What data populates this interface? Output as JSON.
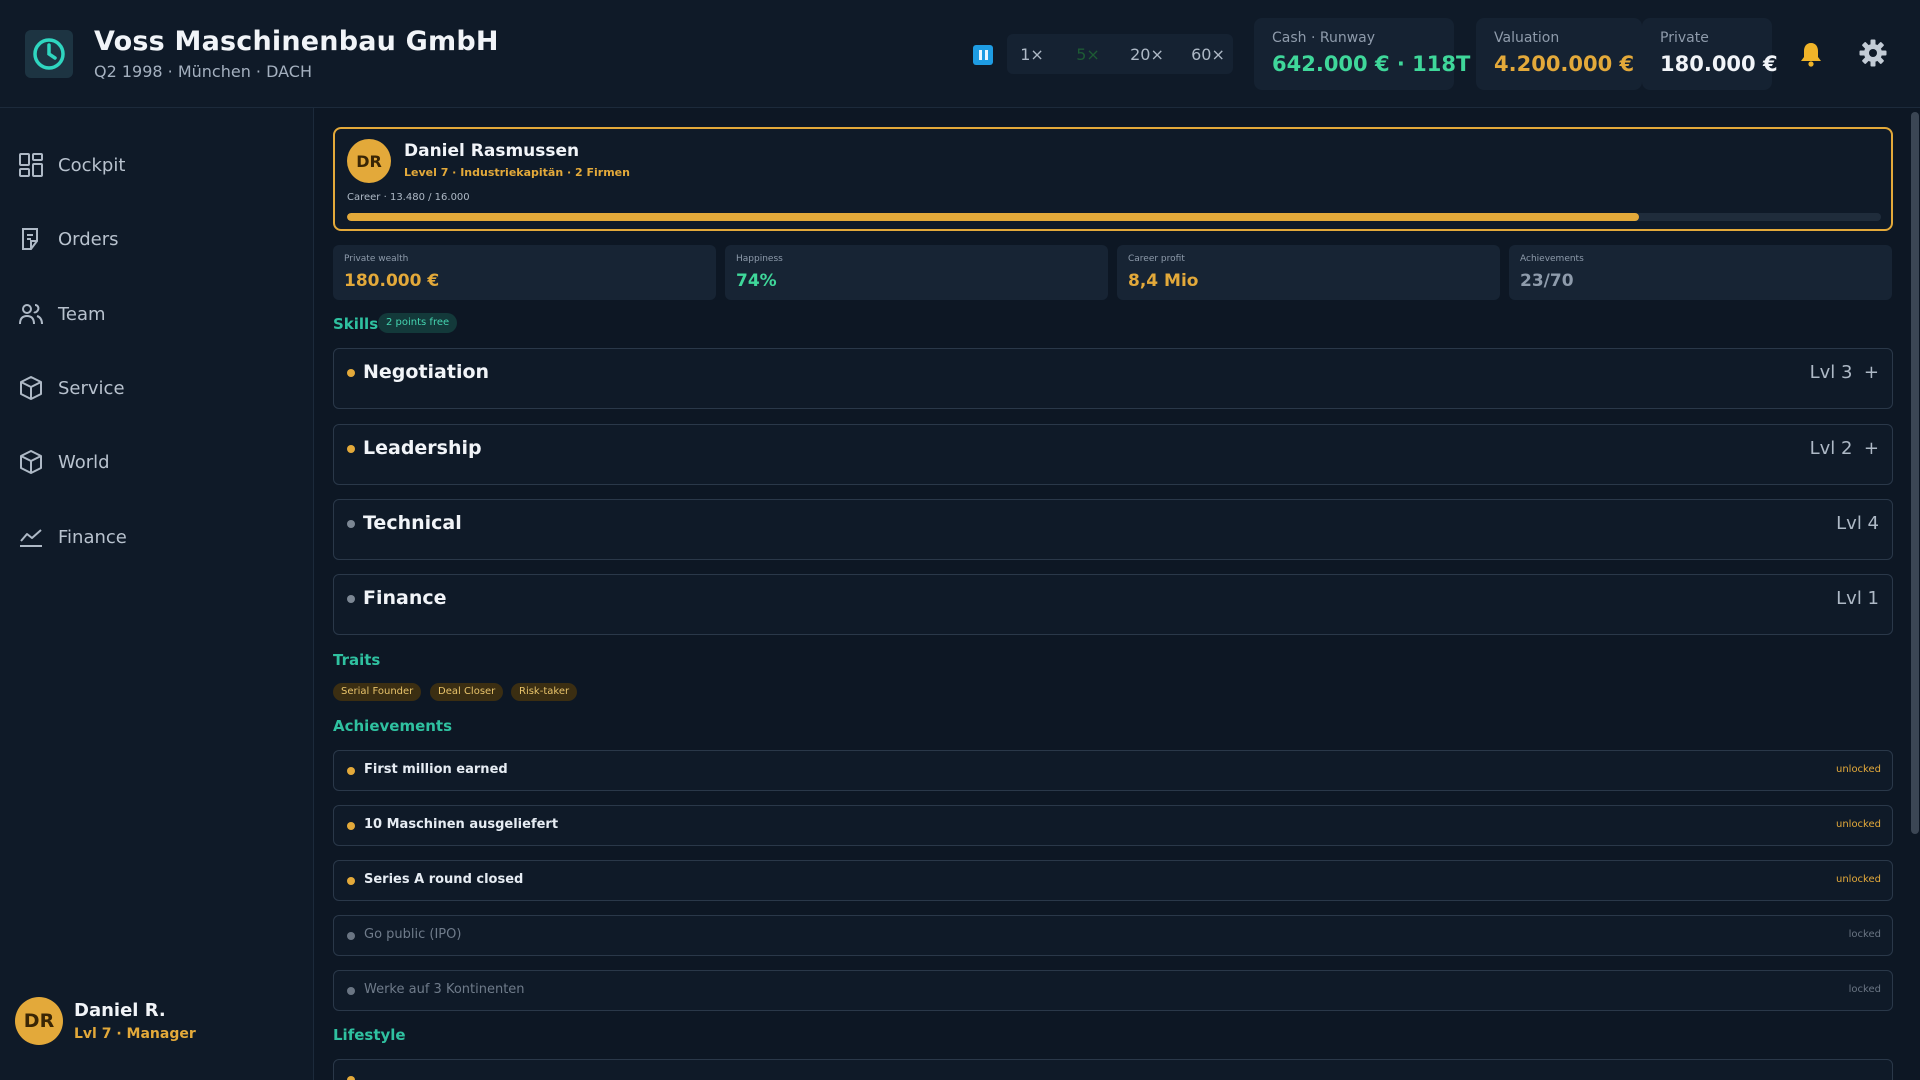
{
  "header": {
    "company_name": "Voss Maschinenbau GmbH",
    "company_sub": "Q2 1998 · München · DACH",
    "speeds": [
      "1×",
      "5×",
      "20×",
      "60×"
    ],
    "active_speed": "5×",
    "kpis": {
      "cash_label": "Cash · Runway",
      "cash_value": "642.000 € · 118T",
      "valuation_label": "Valuation",
      "valuation_value": "4.200.000 €",
      "private_label": "Private",
      "private_value": "180.000 €"
    }
  },
  "sidebar": {
    "items": [
      {
        "label": "Cockpit",
        "icon": "dashboard-icon"
      },
      {
        "label": "Orders",
        "icon": "clipboard-icon"
      },
      {
        "label": "Team",
        "icon": "users-icon"
      },
      {
        "label": "Service",
        "icon": "box-icon"
      },
      {
        "label": "World",
        "icon": "box-icon"
      },
      {
        "label": "Finance",
        "icon": "chart-line-icon"
      }
    ],
    "user": {
      "initials": "DR",
      "name": "Daniel R.",
      "level": "Lvl 7 · Manager"
    }
  },
  "profile": {
    "initials": "DR",
    "name": "Daniel Rasmussen",
    "subtitle": "Level 7 · Industriekapitän · 2 Firmen",
    "career_label": "Career · 13.480 / 16.000",
    "career_progress": 0.8425
  },
  "stats": [
    {
      "label": "Private wealth",
      "value": "180.000 €"
    },
    {
      "label": "Happiness",
      "value": "74%"
    },
    {
      "label": "Career profit",
      "value": "8,4 Mio"
    },
    {
      "label": "Achievements",
      "value": "23/70"
    }
  ],
  "skills": {
    "title": "Skills",
    "free_badge": "2 points free",
    "items": [
      {
        "name": "Negotiation",
        "level": "Lvl 3",
        "upgradable": true
      },
      {
        "name": "Leadership",
        "level": "Lvl 2",
        "upgradable": true
      },
      {
        "name": "Technical",
        "level": "Lvl 4",
        "upgradable": false
      },
      {
        "name": "Finance",
        "level": "Lvl 1",
        "upgradable": false
      }
    ],
    "plus": "+"
  },
  "traits": {
    "title": "Traits",
    "items": [
      "Serial Founder",
      "Deal Closer",
      "Risk-taker"
    ]
  },
  "achievements": {
    "title": "Achievements",
    "items": [
      {
        "name": "First million earned",
        "status": "unlocked"
      },
      {
        "name": "10 Maschinen ausgeliefert",
        "status": "unlocked"
      },
      {
        "name": "Series A round closed",
        "status": "unlocked"
      },
      {
        "name": "Go public (IPO)",
        "status": "locked"
      },
      {
        "name": "Werke auf 3 Kontinenten",
        "status": "locked"
      }
    ]
  },
  "lifestyle": {
    "title": "Lifestyle"
  },
  "colors": {
    "accent_gold": "#e3a93a",
    "accent_teal": "#2fc1a0",
    "positive_green": "#3fd79a",
    "pause_blue": "#1e9ce3",
    "background": "#0d1724"
  }
}
